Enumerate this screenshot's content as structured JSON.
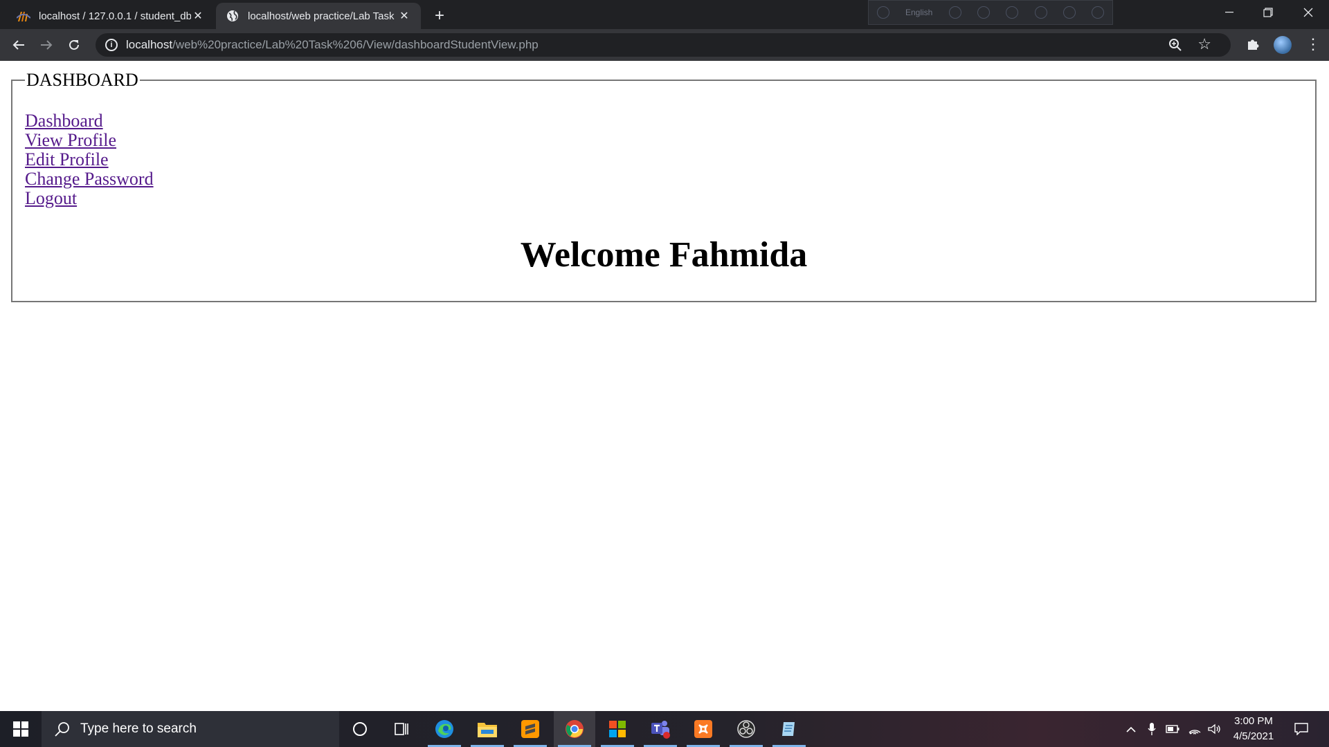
{
  "browser": {
    "tabs": [
      {
        "title": "localhost / 127.0.0.1 / student_db",
        "favicon": "phpmyadmin-icon"
      },
      {
        "title": "localhost/web practice/Lab Task 6",
        "favicon": "globe-icon"
      }
    ],
    "new_tab_label": "+",
    "ime": {
      "language": "English"
    },
    "address": {
      "host": "localhost",
      "path": "/web%20practice/Lab%20Task%206/View/dashboardStudentView.php"
    }
  },
  "page": {
    "legend": "DASHBOARD",
    "links": [
      {
        "label": "Dashboard"
      },
      {
        "label": "View Profile"
      },
      {
        "label": "Edit Profile"
      },
      {
        "label": "Change Password"
      },
      {
        "label": "Logout"
      }
    ],
    "welcome": "Welcome Fahmida"
  },
  "taskbar": {
    "search_placeholder": "Type here to search",
    "apps": [
      "cortana-icon",
      "task-view-icon",
      "edge-icon",
      "file-explorer-icon",
      "sublime-text-icon",
      "chrome-icon",
      "windows-store-icon",
      "teams-icon",
      "xampp-icon",
      "obs-icon",
      "notepad-icon"
    ],
    "clock": {
      "time": "3:00 PM",
      "date": "4/5/2021"
    }
  },
  "colors": {
    "tabstrip": "#202124",
    "toolbar": "#35363a",
    "visited_link": "#551a8b",
    "fieldset_border": "#767676"
  }
}
